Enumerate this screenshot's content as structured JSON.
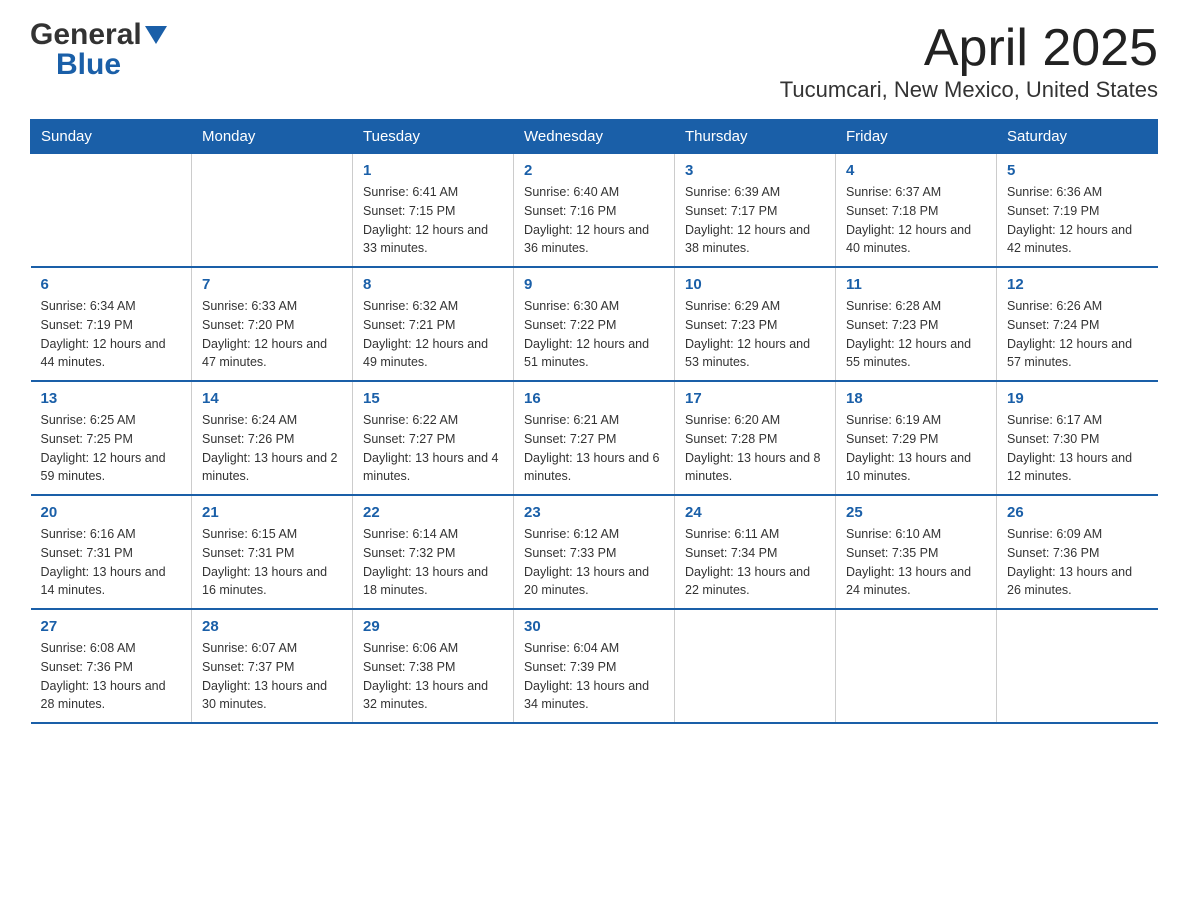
{
  "header": {
    "logo_general": "General",
    "logo_blue": "Blue",
    "title": "April 2025",
    "subtitle": "Tucumcari, New Mexico, United States"
  },
  "days_of_week": [
    "Sunday",
    "Monday",
    "Tuesday",
    "Wednesday",
    "Thursday",
    "Friday",
    "Saturday"
  ],
  "weeks": [
    [
      {
        "day": "",
        "sunrise": "",
        "sunset": "",
        "daylight": ""
      },
      {
        "day": "",
        "sunrise": "",
        "sunset": "",
        "daylight": ""
      },
      {
        "day": "1",
        "sunrise": "Sunrise: 6:41 AM",
        "sunset": "Sunset: 7:15 PM",
        "daylight": "Daylight: 12 hours and 33 minutes."
      },
      {
        "day": "2",
        "sunrise": "Sunrise: 6:40 AM",
        "sunset": "Sunset: 7:16 PM",
        "daylight": "Daylight: 12 hours and 36 minutes."
      },
      {
        "day": "3",
        "sunrise": "Sunrise: 6:39 AM",
        "sunset": "Sunset: 7:17 PM",
        "daylight": "Daylight: 12 hours and 38 minutes."
      },
      {
        "day": "4",
        "sunrise": "Sunrise: 6:37 AM",
        "sunset": "Sunset: 7:18 PM",
        "daylight": "Daylight: 12 hours and 40 minutes."
      },
      {
        "day": "5",
        "sunrise": "Sunrise: 6:36 AM",
        "sunset": "Sunset: 7:19 PM",
        "daylight": "Daylight: 12 hours and 42 minutes."
      }
    ],
    [
      {
        "day": "6",
        "sunrise": "Sunrise: 6:34 AM",
        "sunset": "Sunset: 7:19 PM",
        "daylight": "Daylight: 12 hours and 44 minutes."
      },
      {
        "day": "7",
        "sunrise": "Sunrise: 6:33 AM",
        "sunset": "Sunset: 7:20 PM",
        "daylight": "Daylight: 12 hours and 47 minutes."
      },
      {
        "day": "8",
        "sunrise": "Sunrise: 6:32 AM",
        "sunset": "Sunset: 7:21 PM",
        "daylight": "Daylight: 12 hours and 49 minutes."
      },
      {
        "day": "9",
        "sunrise": "Sunrise: 6:30 AM",
        "sunset": "Sunset: 7:22 PM",
        "daylight": "Daylight: 12 hours and 51 minutes."
      },
      {
        "day": "10",
        "sunrise": "Sunrise: 6:29 AM",
        "sunset": "Sunset: 7:23 PM",
        "daylight": "Daylight: 12 hours and 53 minutes."
      },
      {
        "day": "11",
        "sunrise": "Sunrise: 6:28 AM",
        "sunset": "Sunset: 7:23 PM",
        "daylight": "Daylight: 12 hours and 55 minutes."
      },
      {
        "day": "12",
        "sunrise": "Sunrise: 6:26 AM",
        "sunset": "Sunset: 7:24 PM",
        "daylight": "Daylight: 12 hours and 57 minutes."
      }
    ],
    [
      {
        "day": "13",
        "sunrise": "Sunrise: 6:25 AM",
        "sunset": "Sunset: 7:25 PM",
        "daylight": "Daylight: 12 hours and 59 minutes."
      },
      {
        "day": "14",
        "sunrise": "Sunrise: 6:24 AM",
        "sunset": "Sunset: 7:26 PM",
        "daylight": "Daylight: 13 hours and 2 minutes."
      },
      {
        "day": "15",
        "sunrise": "Sunrise: 6:22 AM",
        "sunset": "Sunset: 7:27 PM",
        "daylight": "Daylight: 13 hours and 4 minutes."
      },
      {
        "day": "16",
        "sunrise": "Sunrise: 6:21 AM",
        "sunset": "Sunset: 7:27 PM",
        "daylight": "Daylight: 13 hours and 6 minutes."
      },
      {
        "day": "17",
        "sunrise": "Sunrise: 6:20 AM",
        "sunset": "Sunset: 7:28 PM",
        "daylight": "Daylight: 13 hours and 8 minutes."
      },
      {
        "day": "18",
        "sunrise": "Sunrise: 6:19 AM",
        "sunset": "Sunset: 7:29 PM",
        "daylight": "Daylight: 13 hours and 10 minutes."
      },
      {
        "day": "19",
        "sunrise": "Sunrise: 6:17 AM",
        "sunset": "Sunset: 7:30 PM",
        "daylight": "Daylight: 13 hours and 12 minutes."
      }
    ],
    [
      {
        "day": "20",
        "sunrise": "Sunrise: 6:16 AM",
        "sunset": "Sunset: 7:31 PM",
        "daylight": "Daylight: 13 hours and 14 minutes."
      },
      {
        "day": "21",
        "sunrise": "Sunrise: 6:15 AM",
        "sunset": "Sunset: 7:31 PM",
        "daylight": "Daylight: 13 hours and 16 minutes."
      },
      {
        "day": "22",
        "sunrise": "Sunrise: 6:14 AM",
        "sunset": "Sunset: 7:32 PM",
        "daylight": "Daylight: 13 hours and 18 minutes."
      },
      {
        "day": "23",
        "sunrise": "Sunrise: 6:12 AM",
        "sunset": "Sunset: 7:33 PM",
        "daylight": "Daylight: 13 hours and 20 minutes."
      },
      {
        "day": "24",
        "sunrise": "Sunrise: 6:11 AM",
        "sunset": "Sunset: 7:34 PM",
        "daylight": "Daylight: 13 hours and 22 minutes."
      },
      {
        "day": "25",
        "sunrise": "Sunrise: 6:10 AM",
        "sunset": "Sunset: 7:35 PM",
        "daylight": "Daylight: 13 hours and 24 minutes."
      },
      {
        "day": "26",
        "sunrise": "Sunrise: 6:09 AM",
        "sunset": "Sunset: 7:36 PM",
        "daylight": "Daylight: 13 hours and 26 minutes."
      }
    ],
    [
      {
        "day": "27",
        "sunrise": "Sunrise: 6:08 AM",
        "sunset": "Sunset: 7:36 PM",
        "daylight": "Daylight: 13 hours and 28 minutes."
      },
      {
        "day": "28",
        "sunrise": "Sunrise: 6:07 AM",
        "sunset": "Sunset: 7:37 PM",
        "daylight": "Daylight: 13 hours and 30 minutes."
      },
      {
        "day": "29",
        "sunrise": "Sunrise: 6:06 AM",
        "sunset": "Sunset: 7:38 PM",
        "daylight": "Daylight: 13 hours and 32 minutes."
      },
      {
        "day": "30",
        "sunrise": "Sunrise: 6:04 AM",
        "sunset": "Sunset: 7:39 PM",
        "daylight": "Daylight: 13 hours and 34 minutes."
      },
      {
        "day": "",
        "sunrise": "",
        "sunset": "",
        "daylight": ""
      },
      {
        "day": "",
        "sunrise": "",
        "sunset": "",
        "daylight": ""
      },
      {
        "day": "",
        "sunrise": "",
        "sunset": "",
        "daylight": ""
      }
    ]
  ]
}
